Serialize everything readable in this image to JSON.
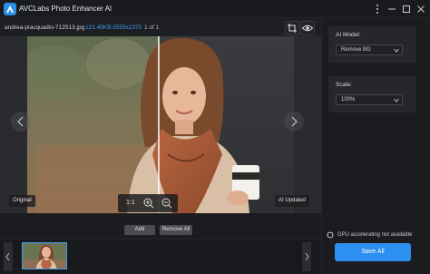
{
  "window": {
    "title": "AVCLabs Photo Enhancer AI",
    "accent_color": "#2d8ff0"
  },
  "infobar": {
    "filename": "andrea-piacquadio-712513.jpg",
    "filesize": "121.45KB",
    "dimensions": "3555x2370",
    "page_indicator": "1 of 1"
  },
  "preview": {
    "original_tag": "Original",
    "updated_tag": "AI Updated",
    "zoom_label": "1:1"
  },
  "actions": {
    "add_label": "Add",
    "remove_all_label": "Remove All"
  },
  "panel": {
    "model": {
      "title": "AI Model:",
      "selected": "Remove BG"
    },
    "scale": {
      "title": "Scale:",
      "selected": "100%"
    },
    "gpu_text": "GPU accelerating not available",
    "save_label": "Save All"
  }
}
